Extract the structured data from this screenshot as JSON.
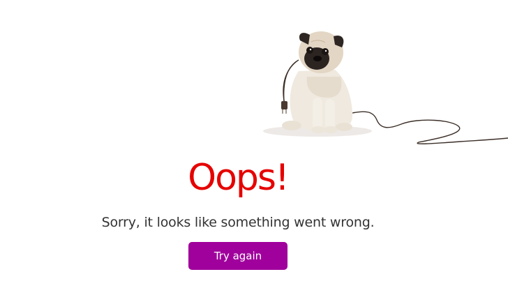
{
  "error": {
    "heading": "Oops!",
    "message": "Sorry, it looks like something went wrong.",
    "retry_label": "Try again"
  },
  "illustration": {
    "icon": "pug-with-unplugged-cable-icon"
  },
  "colors": {
    "heading": "#e60000",
    "button": "#a0009c",
    "text": "#333333",
    "background": "#ffffff"
  }
}
